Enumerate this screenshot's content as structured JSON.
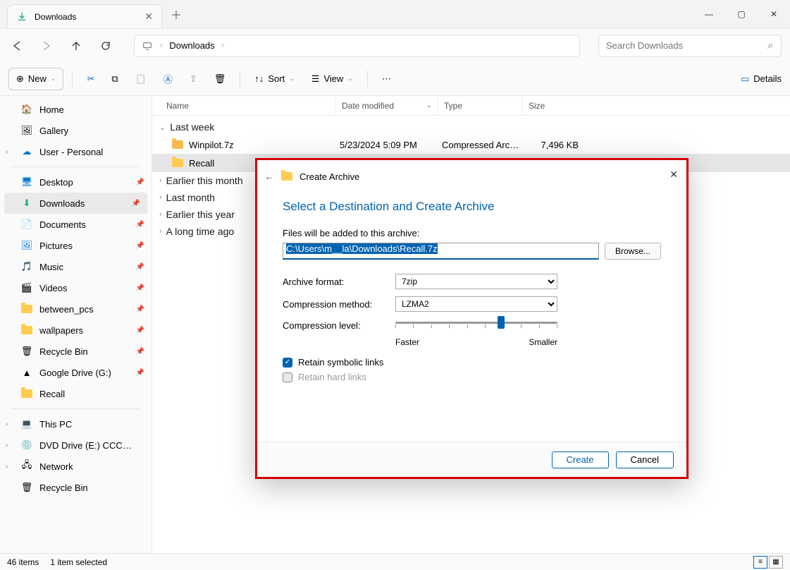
{
  "tab": {
    "title": "Downloads"
  },
  "breadcrumb": {
    "loc": "Downloads"
  },
  "search": {
    "placeholder": "Search Downloads"
  },
  "toolbar": {
    "new": "New",
    "sort": "Sort",
    "view": "View",
    "details": "Details"
  },
  "columns": {
    "name": "Name",
    "date": "Date modified",
    "type": "Type",
    "size": "Size"
  },
  "sidebar": {
    "home": "Home",
    "gallery": "Gallery",
    "user": "User - Personal",
    "desktop": "Desktop",
    "downloads": "Downloads",
    "documents": "Documents",
    "pictures": "Pictures",
    "music": "Music",
    "videos": "Videos",
    "between": "between_pcs",
    "wallpapers": "wallpapers",
    "recycle": "Recycle Bin",
    "gdrive": "Google Drive (G:)",
    "recall": "Recall",
    "thispc": "This PC",
    "dvd": "DVD Drive (E:) CCCOMA_X64",
    "network": "Network",
    "recycle2": "Recycle Bin"
  },
  "groups": {
    "lastweek": "Last week",
    "earliermonth": "Earlier this month",
    "lastmonth": "Last month",
    "earlieryear": "Earlier this year",
    "longtime": "A long time ago"
  },
  "files": {
    "winpilot": {
      "name": "Winpilot.7z",
      "date": "5/23/2024 5:09 PM",
      "type": "Compressed Archi...",
      "size": "7,496 KB"
    },
    "recall": {
      "name": "Recall"
    }
  },
  "status": {
    "count": "46 items",
    "selected": "1 item selected"
  },
  "dialog": {
    "title": "Create Archive",
    "heading": "Select a Destination and Create Archive",
    "filesLabel": "Files will be added to this archive:",
    "path": "C:\\Users\\m__la\\Downloads\\Recall.7z",
    "browse": "Browse...",
    "formatLabel": "Archive format:",
    "formatValue": "7zip",
    "methodLabel": "Compression method:",
    "methodValue": "LZMA2",
    "levelLabel": "Compression level:",
    "faster": "Faster",
    "smaller": "Smaller",
    "symlinks": "Retain symbolic links",
    "hardlinks": "Retain hard links",
    "create": "Create",
    "cancel": "Cancel"
  }
}
